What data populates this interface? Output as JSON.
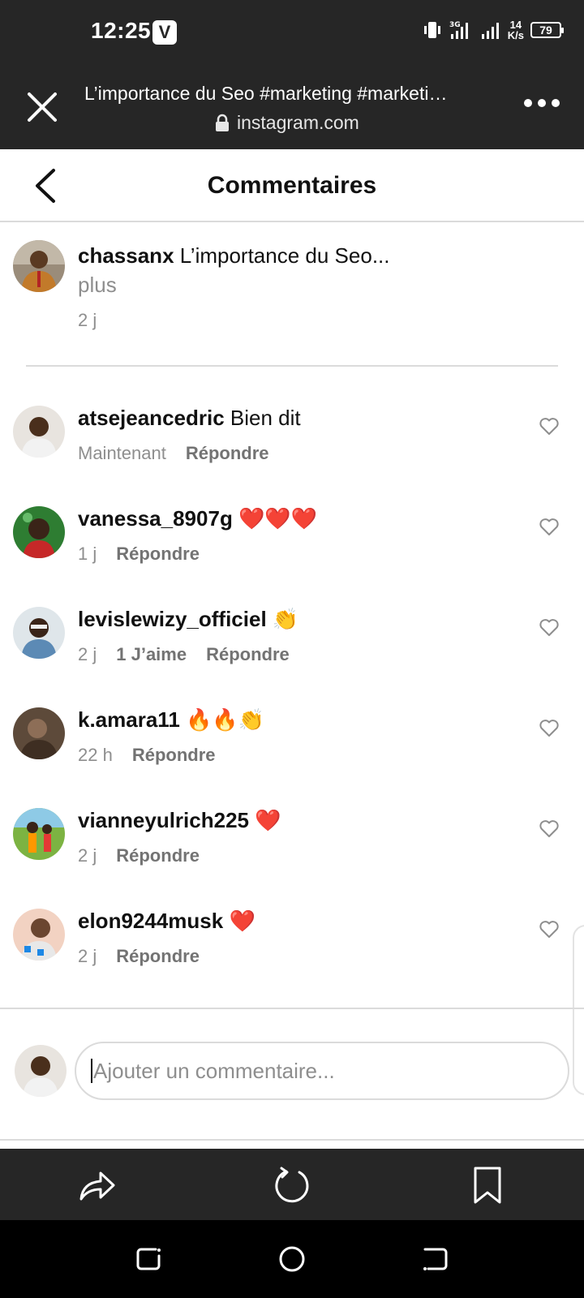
{
  "status_bar": {
    "time": "12:25",
    "app_badge": "V",
    "speed_top": "14",
    "speed_bottom": "K/s",
    "battery": "79"
  },
  "browser": {
    "page_title": "L’importance du Seo #marketing #marketi…",
    "url": "instagram.com"
  },
  "header": {
    "title": "Commentaires"
  },
  "caption": {
    "username": "chassanx",
    "text": "L’importance du Seo...",
    "more_label": "plus",
    "time": "2 j"
  },
  "comments": [
    {
      "username": "atsejeancedric",
      "text": "Bien dit",
      "time": "Maintenant",
      "likes": "",
      "reply_label": "Répondre"
    },
    {
      "username": "vanessa_8907g",
      "text": "❤️❤️❤️",
      "time": "1 j",
      "likes": "",
      "reply_label": "Répondre"
    },
    {
      "username": "levislewizy_officiel",
      "text": "👏",
      "time": "2 j",
      "likes": "1 J’aime",
      "reply_label": "Répondre"
    },
    {
      "username": "k.amara11",
      "text": "🔥🔥👏",
      "time": "22 h",
      "likes": "",
      "reply_label": "Répondre"
    },
    {
      "username": "vianneyulrich225",
      "text": "❤️",
      "time": "2 j",
      "likes": "",
      "reply_label": "Répondre"
    },
    {
      "username": "elon9244musk",
      "text": "❤️",
      "time": "2 j",
      "likes": "",
      "reply_label": "Répondre"
    }
  ],
  "composer": {
    "placeholder": "Ajouter un commentaire..."
  },
  "colors": {
    "chrome_dark": "#262626",
    "muted_text": "#8e8e8e",
    "divider": "#dbdbdb",
    "heart_red": "#ed1c24"
  },
  "icons": {
    "close": "close-icon",
    "lock": "lock-icon",
    "more": "more-icon",
    "back": "chevron-left-icon",
    "heart": "heart-outline-icon",
    "share": "share-icon",
    "refresh": "refresh-icon",
    "bookmark": "bookmark-icon"
  }
}
